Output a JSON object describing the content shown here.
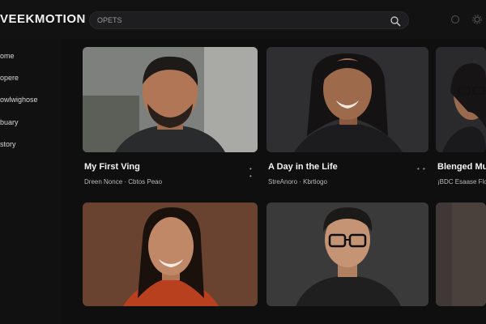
{
  "app": {
    "title": "VEEKMOTION"
  },
  "search": {
    "placeholder": "OPETS"
  },
  "sidebar": {
    "items": [
      {
        "label": "ome"
      },
      {
        "label": "opere"
      },
      {
        "label": "owlwighose"
      },
      {
        "label": "buary"
      },
      {
        "label": "story"
      }
    ]
  },
  "videos": [
    {
      "title": "My First Ving",
      "meta": "Dreen Nonce  · Cbtos  Peao",
      "more": "• •"
    },
    {
      "title": "A Day in the Life",
      "meta": "StreAnoro  ·  Kbrtiogo",
      "more": "• •"
    },
    {
      "title": "Blenged Mus",
      "meta": "¡BDC  Esaase  Floe"
    },
    {
      "title": "",
      "meta": ""
    },
    {
      "title": "",
      "meta": ""
    },
    {
      "title": "",
      "meta": ""
    }
  ],
  "colors": {
    "background": "#0f0f10",
    "surface": "#1e1e20",
    "text": "#f2f2f2"
  },
  "icons": {
    "search": "search-icon",
    "top_left": "bell-icon",
    "top_right": "settings-icon"
  }
}
